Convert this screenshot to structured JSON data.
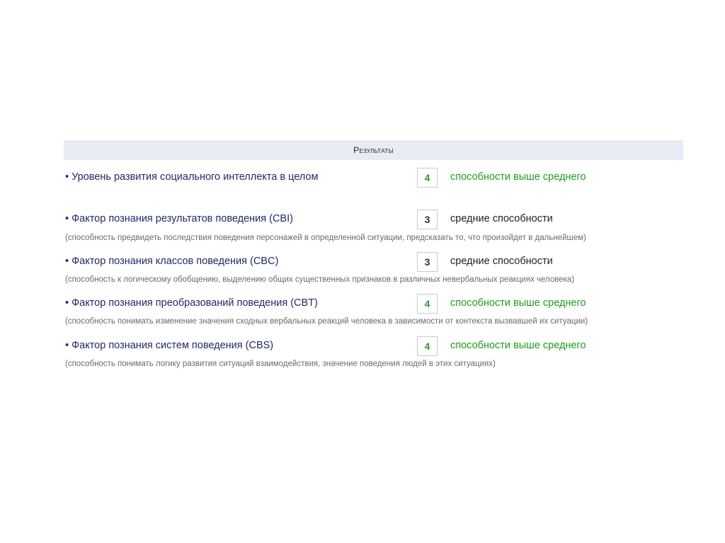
{
  "header": {
    "title": "Результаты"
  },
  "overall": {
    "label": "• Уровень развития социального интеллекта в целом",
    "score": "4",
    "level": "способности выше среднего"
  },
  "factors": [
    {
      "label": "• Фактор познания результатов поведения (CBI)",
      "score": "3",
      "level": "средние способности",
      "description": "(способность предвидеть последствия поведения персонажей в определенной ситуации, предсказать то, что произойдет в дальнейшем)"
    },
    {
      "label": "• Фактор познания классов поведения (CBC)",
      "score": "3",
      "level": "средние способности",
      "description": "(способность к логическому обобщению, выделению общих существенных признаков в различных невербальных реакциях человека)"
    },
    {
      "label": "• Фактор познания преобразований поведения (CBT)",
      "score": "4",
      "level": "способности выше среднего",
      "description": "(способность понимать изменение значения сходных вербальных реакций человека в зависимости от контекста вызвавшей их ситуации)"
    },
    {
      "label": "• Фактор познания систем поведения (CBS)",
      "score": "4",
      "level": "способности выше среднего",
      "description": "(способность понимать логику развития ситуаций взаимодействия, значение поведения людей в этих ситуациях)"
    }
  ],
  "colors": {
    "header_bg": "#e9ebf4",
    "label_text": "#1f2a66",
    "high_level": "#1d9c1d",
    "mid_level": "#222222",
    "description": "#6a6a6a"
  }
}
